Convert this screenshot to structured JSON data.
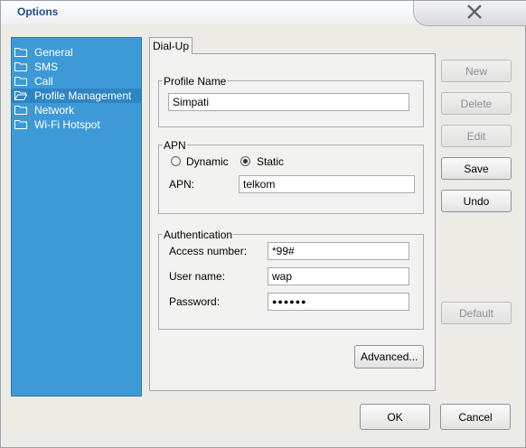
{
  "window": {
    "title": "Options"
  },
  "sidebar": {
    "items": [
      {
        "label": "General",
        "selected": false
      },
      {
        "label": "SMS",
        "selected": false
      },
      {
        "label": "Call",
        "selected": false
      },
      {
        "label": "Profile Management",
        "selected": true
      },
      {
        "label": "Network",
        "selected": false
      },
      {
        "label": "Wi-Fi Hotspot",
        "selected": false
      }
    ]
  },
  "tabs": [
    {
      "label": "Dial-Up"
    }
  ],
  "profile": {
    "group_title": "Profile Name",
    "name_value": "Simpati"
  },
  "apn": {
    "group_title": "APN",
    "dynamic_label": "Dynamic",
    "static_label": "Static",
    "selected": "Static",
    "apn_label": "APN:",
    "apn_value": "telkom"
  },
  "auth": {
    "group_title": "Authentication",
    "access_label": "Access number:",
    "access_value": "*99#",
    "user_label": "User name:",
    "user_value": "wap",
    "password_label": "Password:",
    "password_value": "●●●●●●"
  },
  "buttons": {
    "new": "New",
    "delete": "Delete",
    "edit": "Edit",
    "save": "Save",
    "undo": "Undo",
    "default": "Default",
    "advanced": "Advanced...",
    "ok": "OK",
    "cancel": "Cancel"
  },
  "icons": {
    "folder": "folder-icon",
    "close": "close-icon"
  },
  "colors": {
    "sidebar_bg": "#3e9ad7",
    "selected_bg": "#2f84c2",
    "title": "#1f4e8a"
  }
}
